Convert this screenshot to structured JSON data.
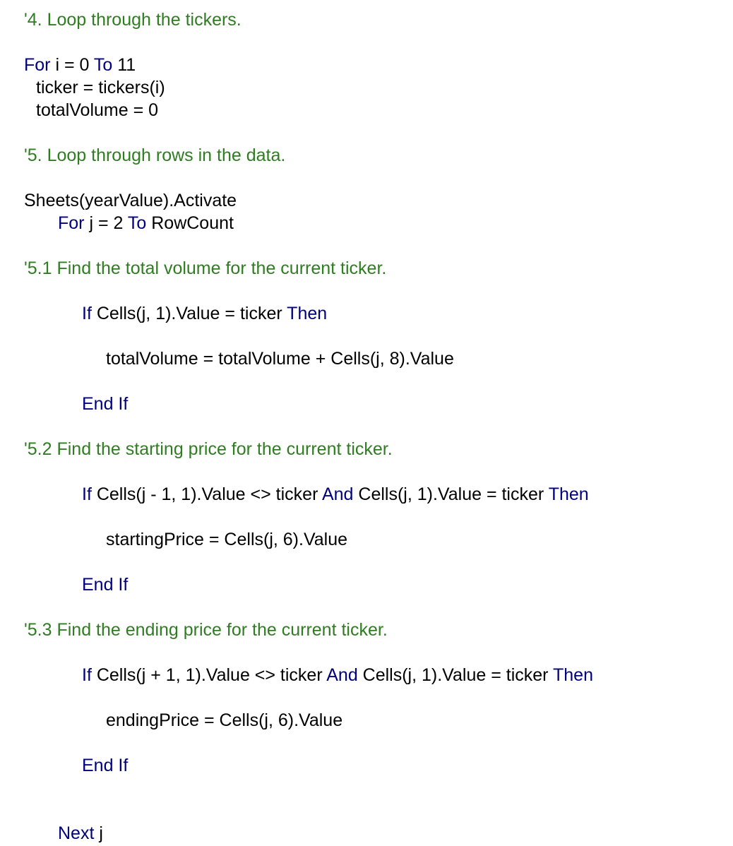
{
  "colors": {
    "comment": "#2f7d21",
    "keyword": "#00007f",
    "text": "#000000"
  },
  "code": {
    "l1": {
      "comment": "'4. Loop through the tickers."
    },
    "l2": {
      "k1": "For",
      "t1": " i = 0 ",
      "k2": "To",
      "t2": " 11"
    },
    "l3": {
      "t1": "ticker = tickers(i)"
    },
    "l4": {
      "t1": "totalVolume = 0"
    },
    "l5": {
      "comment": "'5. Loop through rows in the data."
    },
    "l6": {
      "t1": "Sheets(yearValue).Activate"
    },
    "l7": {
      "k1": "For",
      "t1": " j = 2 ",
      "k2": "To",
      "t2": " RowCount"
    },
    "l8": {
      "comment": "'5.1 Find the total volume for the current ticker."
    },
    "l9": {
      "k1": "If",
      "t1": " Cells(j, 1).Value = ticker ",
      "k2": "Then"
    },
    "l10": {
      "t1": "totalVolume = totalVolume + Cells(j, 8).Value"
    },
    "l11": {
      "k1": "End If"
    },
    "l12": {
      "comment": "'5.2 Find the starting price for the current ticker."
    },
    "l13": {
      "k1": "If",
      "t1": " Cells(j - 1, 1).Value <> ticker ",
      "k2": "And",
      "t2": " Cells(j, 1).Value = ticker ",
      "k3": "Then"
    },
    "l14": {
      "t1": "startingPrice = Cells(j, 6).Value"
    },
    "l15": {
      "k1": "End If"
    },
    "l16": {
      "comment": "'5.3 Find the ending price for the current ticker."
    },
    "l17": {
      "k1": "If",
      "t1": " Cells(j + 1, 1).Value <> ticker ",
      "k2": "And",
      "t2": " Cells(j, 1).Value = ticker ",
      "k3": "Then"
    },
    "l18": {
      "t1": "endingPrice = Cells(j, 6).Value"
    },
    "l19": {
      "k1": "End If"
    },
    "l20": {
      "k1": "Next",
      "t1": " j"
    }
  }
}
